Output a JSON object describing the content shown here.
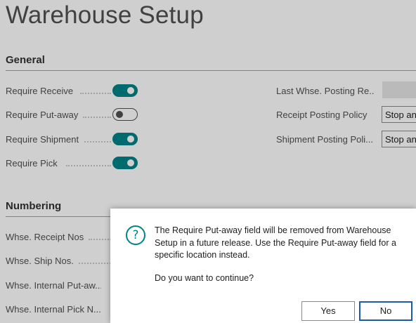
{
  "page": {
    "title": "Warehouse Setup"
  },
  "general": {
    "header": "General",
    "toggles": [
      {
        "label": "Require Receive",
        "on": true
      },
      {
        "label": "Require Put-away",
        "on": false
      },
      {
        "label": "Require Shipment",
        "on": true
      },
      {
        "label": "Require Pick",
        "on": true
      }
    ],
    "right_fields": [
      {
        "label": "Last Whse. Posting Re...",
        "value": ""
      },
      {
        "label": "Receipt Posting Policy",
        "value": "Stop and"
      },
      {
        "label": "Shipment Posting Poli...",
        "value": "Stop and"
      }
    ]
  },
  "numbering": {
    "header": "Numbering",
    "fields": [
      {
        "label": "Whse. Receipt Nos."
      },
      {
        "label": "Whse. Ship Nos."
      },
      {
        "label": "Whse. Internal Put-aw..."
      },
      {
        "label": "Whse. Internal Pick N..."
      }
    ]
  },
  "dialog": {
    "icon": "question-circle-icon",
    "message": "The Require Put-away field will be removed from Warehouse Setup in a future release. Use the Require Put-away field for a specific location instead.",
    "question": "Do you want to continue?",
    "yes_label": "Yes",
    "no_label": "No"
  },
  "colors": {
    "accent": "#008489",
    "focus": "#1e5aa8",
    "overlay": "rgba(0,0,0,0.19)"
  }
}
